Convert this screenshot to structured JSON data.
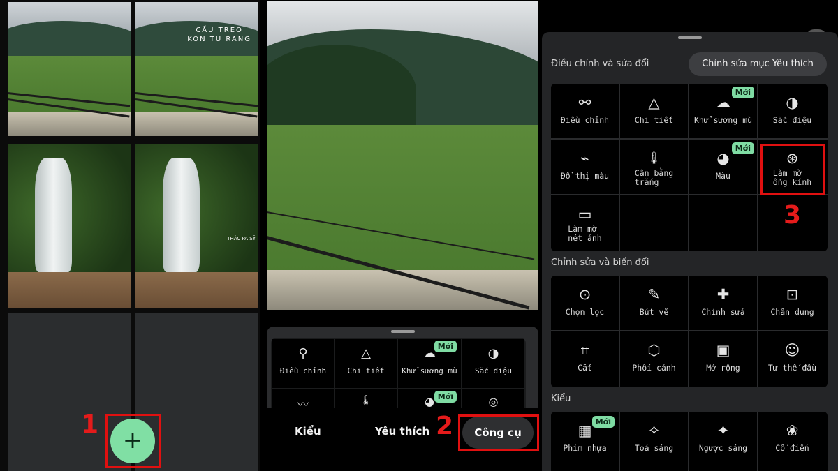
{
  "gallery": {
    "thumb_text_1": "CẦU TREO\nKON TU RANG",
    "thumb_text_2": "THÁC PA SỸ",
    "fab_label": "+",
    "step1": "1"
  },
  "toolbar_preview": {
    "row1": [
      {
        "icon": "sliders-icon",
        "glyph": "⚲",
        "label": "Điều chỉnh"
      },
      {
        "icon": "triangle-icon",
        "glyph": "△",
        "label": "Chi tiết"
      },
      {
        "icon": "dehaze-icon",
        "glyph": "☁",
        "label": "Khử sương mù",
        "badge": "Mới"
      },
      {
        "icon": "tonality-icon",
        "glyph": "◑",
        "label": "Sắc điệu"
      }
    ],
    "row2": [
      {
        "icon": "curve-icon",
        "glyph": "〰"
      },
      {
        "icon": "thermometer-icon",
        "glyph": "🌡"
      },
      {
        "icon": "palette-icon",
        "glyph": "◕",
        "badge": "Mới"
      },
      {
        "icon": "lens-blur-icon",
        "glyph": "◎"
      }
    ]
  },
  "tabs": {
    "styles": "Kiểu",
    "favorites": "Yêu thích",
    "tools": "Công cụ",
    "step2": "2"
  },
  "tools_sheet": {
    "section1_title": "Điều chỉnh và sửa đổi",
    "edit_favorites": "Chỉnh sửa mục Yêu thích",
    "section1_items": [
      {
        "icon": "sliders-icon",
        "glyph": "⚯",
        "label": "Điều chỉnh"
      },
      {
        "icon": "triangle-icon",
        "glyph": "△",
        "label": "Chi tiết"
      },
      {
        "icon": "dehaze-icon",
        "glyph": "☁",
        "label": "Khử sương mù",
        "badge": "Mới"
      },
      {
        "icon": "tonality-icon",
        "glyph": "◑",
        "label": "Sắc điệu"
      },
      {
        "icon": "curve-icon",
        "glyph": "⌁",
        "label": "Đồ thị màu"
      },
      {
        "icon": "thermometer-icon",
        "glyph": "🌡",
        "label": "Cân bằng\ntrắng"
      },
      {
        "icon": "palette-icon",
        "glyph": "◕",
        "label": "Màu",
        "badge": "Mới"
      },
      {
        "icon": "lens-blur-icon",
        "glyph": "⊛",
        "label": "Làm mờ\nống kính"
      },
      {
        "icon": "sharpen-icon",
        "glyph": "▭",
        "label": "Làm mờ\nnét ảnh"
      }
    ],
    "step3": "3",
    "section2_title": "Chỉnh sửa và biến đổi",
    "section2_items": [
      {
        "icon": "selective-icon",
        "glyph": "⊙",
        "label": "Chọn lọc"
      },
      {
        "icon": "brush-icon",
        "glyph": "✎",
        "label": "Bút vẽ"
      },
      {
        "icon": "healing-icon",
        "glyph": "✚",
        "label": "Chỉnh sửa"
      },
      {
        "icon": "portrait-icon",
        "glyph": "⊡",
        "label": "Chân dung"
      },
      {
        "icon": "crop-icon",
        "glyph": "⌗",
        "label": "Cắt"
      },
      {
        "icon": "perspective-icon",
        "glyph": "⬡",
        "label": "Phối cảnh"
      },
      {
        "icon": "expand-icon",
        "glyph": "▣",
        "label": "Mở rộng"
      },
      {
        "icon": "head-pose-icon",
        "glyph": "☺",
        "label": "Tư thế đầu"
      }
    ],
    "section3_title": "Kiểu",
    "section3_items": [
      {
        "icon": "film-icon",
        "glyph": "▦",
        "label": "Phim nhựa",
        "badge": "Mới"
      },
      {
        "icon": "glow-icon",
        "glyph": "✧",
        "label": "Toả sáng"
      },
      {
        "icon": "backlight-icon",
        "glyph": "✦",
        "label": "Ngược sáng"
      },
      {
        "icon": "vintage-icon",
        "glyph": "❀",
        "label": "Cổ điển"
      }
    ]
  }
}
